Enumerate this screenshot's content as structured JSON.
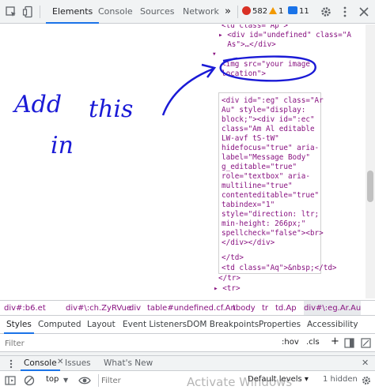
{
  "toolbar": {
    "tabs": [
      "Elements",
      "Console",
      "Sources",
      "Network"
    ],
    "more": "»",
    "errors": "582",
    "warnings": "1",
    "messages": "11",
    "error_color": "#d93025",
    "warning_color": "#f29900",
    "message_color": "#1a73e8"
  },
  "tree": {
    "lines": [
      "<td class=\"Ap\">",
      "▸ <div id=\"undefined\" class=\"A",
      "  As\">…</div>",
      "▾",
      "<img src=\"your image",
      "location\">",
      "",
      "<div id=\":eg\" class=\"Ar",
      "Au\" style=\"display:",
      "block;\"><div id=\":ec\"",
      "class=\"Am Al editable",
      "LW-avf tS-tW\"",
      "hidefocus=\"true\" aria-",
      "label=\"Message Body\"",
      "g_editable=\"true\"",
      "role=\"textbox\" aria-",
      "multiline=\"true\"",
      "contenteditable=\"true\"",
      "tabindex=\"1\"",
      "style=\"direction: ltr;",
      "min-height: 266px;\"",
      "spellcheck=\"false\"><br>",
      "</div></div>",
      "",
      "</td>",
      "<td class=\"Aq\">&nbsp;</td>",
      "</tr>",
      "▸ <tr>"
    ],
    "handwriting": [
      "Add",
      "this",
      "in"
    ]
  },
  "breadcrumbs": [
    "div#:b6.et",
    "div#\\:ch.ZyRVue",
    "div",
    "table#undefined.cf.An",
    "tbody",
    "tr",
    "td.Ap",
    "div#\\:eg.Ar.Au"
  ],
  "styles_tabs": [
    "Styles",
    "Computed",
    "Layout",
    "Event Listeners",
    "DOM Breakpoints",
    "Properties",
    "Accessibility"
  ],
  "filter": {
    "placeholder": "Filter",
    "hov": ":hov",
    "cls": ".cls",
    "plus": "+"
  },
  "drawer": {
    "tabs": [
      "Console",
      "Issues",
      "What's New"
    ],
    "context": "top",
    "filter_placeholder": "Filter",
    "levels": "Default levels ▾",
    "hidden": "1 hidden",
    "watermark": "Activate Windows"
  }
}
